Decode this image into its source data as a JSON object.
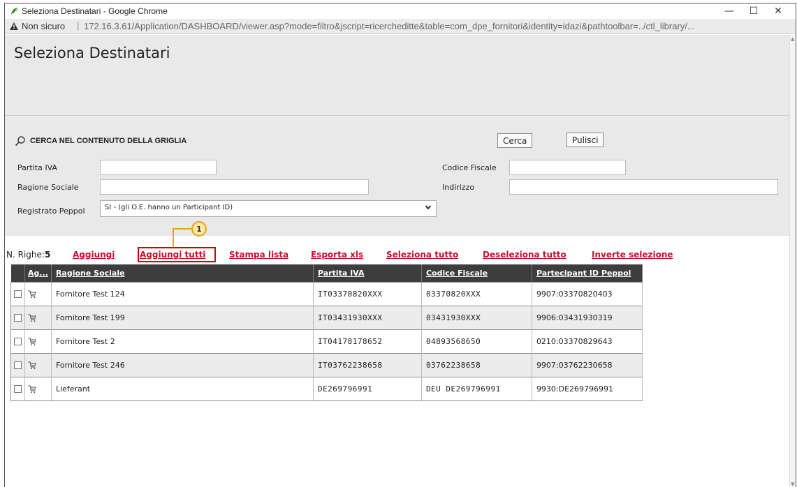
{
  "window": {
    "title": "Seleziona Destinatari - Google Chrome",
    "minimize": "—",
    "maximize": "☐",
    "close": "✕"
  },
  "address_bar": {
    "security_label": "Non sicuro",
    "separator": "|",
    "url": "172.16.3.61/Application/DASHBOARD/viewer.asp?mode=filtro&jscript=ricercheditte&table=com_dpe_fornitori&identity=idazi&pathtoolbar=../ctl_library/..."
  },
  "page": {
    "title": "Seleziona Destinatari"
  },
  "search": {
    "heading": "CERCA NEL CONTENUTO DELLA GRIGLIA",
    "cerca_label": "Cerca",
    "pulisci_label": "Pulisci",
    "fields": {
      "partita_iva": {
        "label": "Partita IVA",
        "value": ""
      },
      "codice_fiscale": {
        "label": "Codice Fiscale",
        "value": ""
      },
      "ragione_sociale": {
        "label": "Ragione Sociale",
        "value": ""
      },
      "indirizzo": {
        "label": "Indirizzo",
        "value": ""
      },
      "registrato_peppol": {
        "label": "Registrato Peppol",
        "value": "SI - (gli O.E. hanno un Participant ID)"
      }
    }
  },
  "toolbar": {
    "n_righe_label": "N. Righe:",
    "n_righe_value": "5",
    "links": {
      "aggiungi": "Aggiungi",
      "aggiungi_tutti": "Aggiungi tutti",
      "stampa_lista": "Stampa lista",
      "esporta_xls": "Esporta xls",
      "seleziona_tutto": "Seleziona tutto",
      "deseleziona_tutto": "Deseleziona tutto",
      "inverte_selezione": "Inverte selezione"
    },
    "callout_number": "1",
    "highlight_color": "#d40000",
    "callout_color": "#e8a020"
  },
  "grid": {
    "columns": [
      "",
      "Ag...",
      "Ragione Sociale",
      "Partita IVA",
      "Codice Fiscale",
      "Partecipant ID Peppol"
    ],
    "rows": [
      {
        "ragione_sociale": "Fornitore Test 124",
        "partita_iva": "IT03370820XXX",
        "codice_fiscale": "03370820XXX",
        "peppol": "9907:03370820403"
      },
      {
        "ragione_sociale": "Fornitore Test 199",
        "partita_iva": "IT03431930XXX",
        "codice_fiscale": "03431930XXX",
        "peppol": "9906:03431930319"
      },
      {
        "ragione_sociale": "Fornitore Test 2",
        "partita_iva": "IT04178178652",
        "codice_fiscale": "04893568650",
        "peppol": "0210:03370829643"
      },
      {
        "ragione_sociale": "Fornitore Test 246",
        "partita_iva": "IT03762238658",
        "codice_fiscale": "03762238658",
        "peppol": "9907:03762230658"
      },
      {
        "ragione_sociale": "Lieferant",
        "partita_iva": "DE269796991",
        "codice_fiscale": "DEU DE269796991",
        "peppol": "9930:DE269796991"
      }
    ],
    "header_bg": "#3d3d3d",
    "link_color": "#c8102e"
  }
}
